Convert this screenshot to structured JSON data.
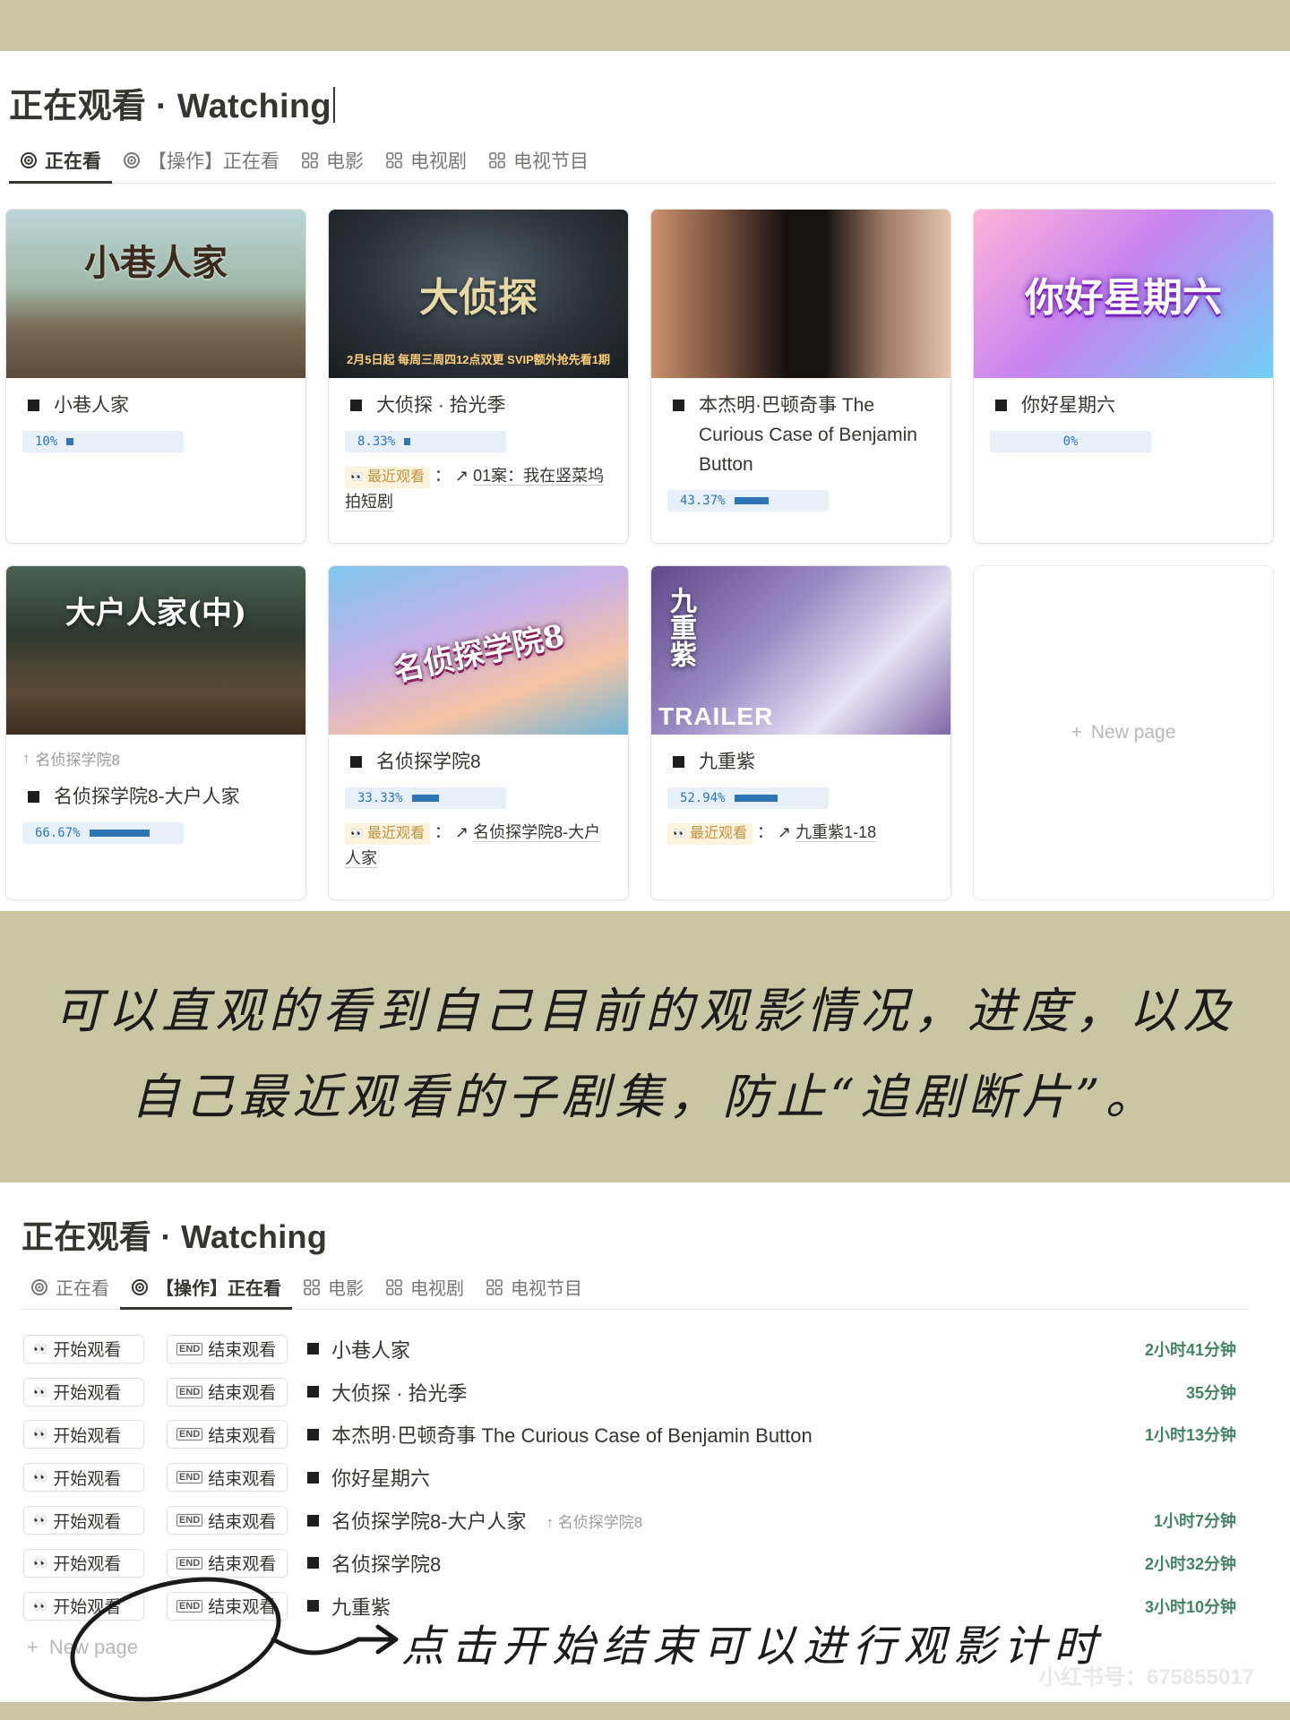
{
  "top": {
    "title": "正在观看 · Watching",
    "tabs": [
      {
        "label": "正在看",
        "icon": "target-icon"
      },
      {
        "label": "【操作】正在看",
        "icon": "target-icon"
      },
      {
        "label": "电影",
        "icon": "grid-icon"
      },
      {
        "label": "电视剧",
        "icon": "grid-icon"
      },
      {
        "label": "电视节目",
        "icon": "grid-icon"
      }
    ],
    "cards": [
      {
        "title": "小巷人家",
        "progress": "10%",
        "progress_value": 10,
        "cover_text": "小巷人家"
      },
      {
        "title": "大侦探 · 拾光季",
        "progress": "8.33%",
        "progress_value": 8.33,
        "cover_text": "大侦探",
        "cover_sub": "2月5日起 每周三周四12点双更 SVIP额外抢先看1期",
        "recent_label": "最近观看",
        "recent_value": "01案：我在竖菜坞拍短剧"
      },
      {
        "title": "本杰明·巴顿奇事 The Curious Case of Benjamin Button",
        "progress": "43.37%",
        "progress_value": 43.37
      },
      {
        "title": "你好星期六",
        "progress": "0%",
        "progress_value": 0,
        "cover_text": "你好星期六"
      },
      {
        "title": "名侦探学院8-大户人家",
        "parent": "名侦探学院8",
        "progress": "66.67%",
        "progress_value": 66.67,
        "cover_text": "大户人家(中)"
      },
      {
        "title": "名侦探学院8",
        "progress": "33.33%",
        "progress_value": 33.33,
        "cover_text": "名侦探学院8",
        "recent_label": "最近观看",
        "recent_value": "名侦探学院8-大户人家"
      },
      {
        "title": "九重紫",
        "progress": "52.94%",
        "progress_value": 52.94,
        "cover_text": "九重紫",
        "cover_badge": "TRAILER",
        "recent_label": "最近观看",
        "recent_value": "九重紫1-18"
      }
    ],
    "new_page": "New page"
  },
  "note1": {
    "line1": "可以直观的看到自己目前的观影情况，进度，以及",
    "line2": "自己最近观看的子剧集，防止“追剧断片”。"
  },
  "bottom": {
    "title": "正在观看 · Watching",
    "tabs": [
      {
        "label": "正在看"
      },
      {
        "label": "【操作】正在看"
      },
      {
        "label": "电影"
      },
      {
        "label": "电视剧"
      },
      {
        "label": "电视节目"
      }
    ],
    "start_label": "开始观看",
    "end_label": "结束观看",
    "rows": [
      {
        "title": "小巷人家",
        "duration": "2小时41分钟"
      },
      {
        "title": "大侦探 · 拾光季",
        "duration": "35分钟"
      },
      {
        "title": "本杰明·巴顿奇事 The Curious Case of Benjamin Button",
        "duration": "1小时13分钟"
      },
      {
        "title": "你好星期六",
        "duration": ""
      },
      {
        "title": "名侦探学院8-大户人家",
        "parent": "名侦探学院8",
        "duration": "1小时7分钟"
      },
      {
        "title": "名侦探学院8",
        "duration": "2小时32分钟"
      },
      {
        "title": "九重紫",
        "duration": "3小时10分钟"
      }
    ],
    "new_page": "New page"
  },
  "note2": "点击开始结束可以进行观影计时",
  "watermark": "小红书号：675855017",
  "colors": {
    "accent_blue": "#2f75b5",
    "duration_green": "#448361",
    "recent_bg": "#fbf3db",
    "band": "#c9c6a4"
  }
}
